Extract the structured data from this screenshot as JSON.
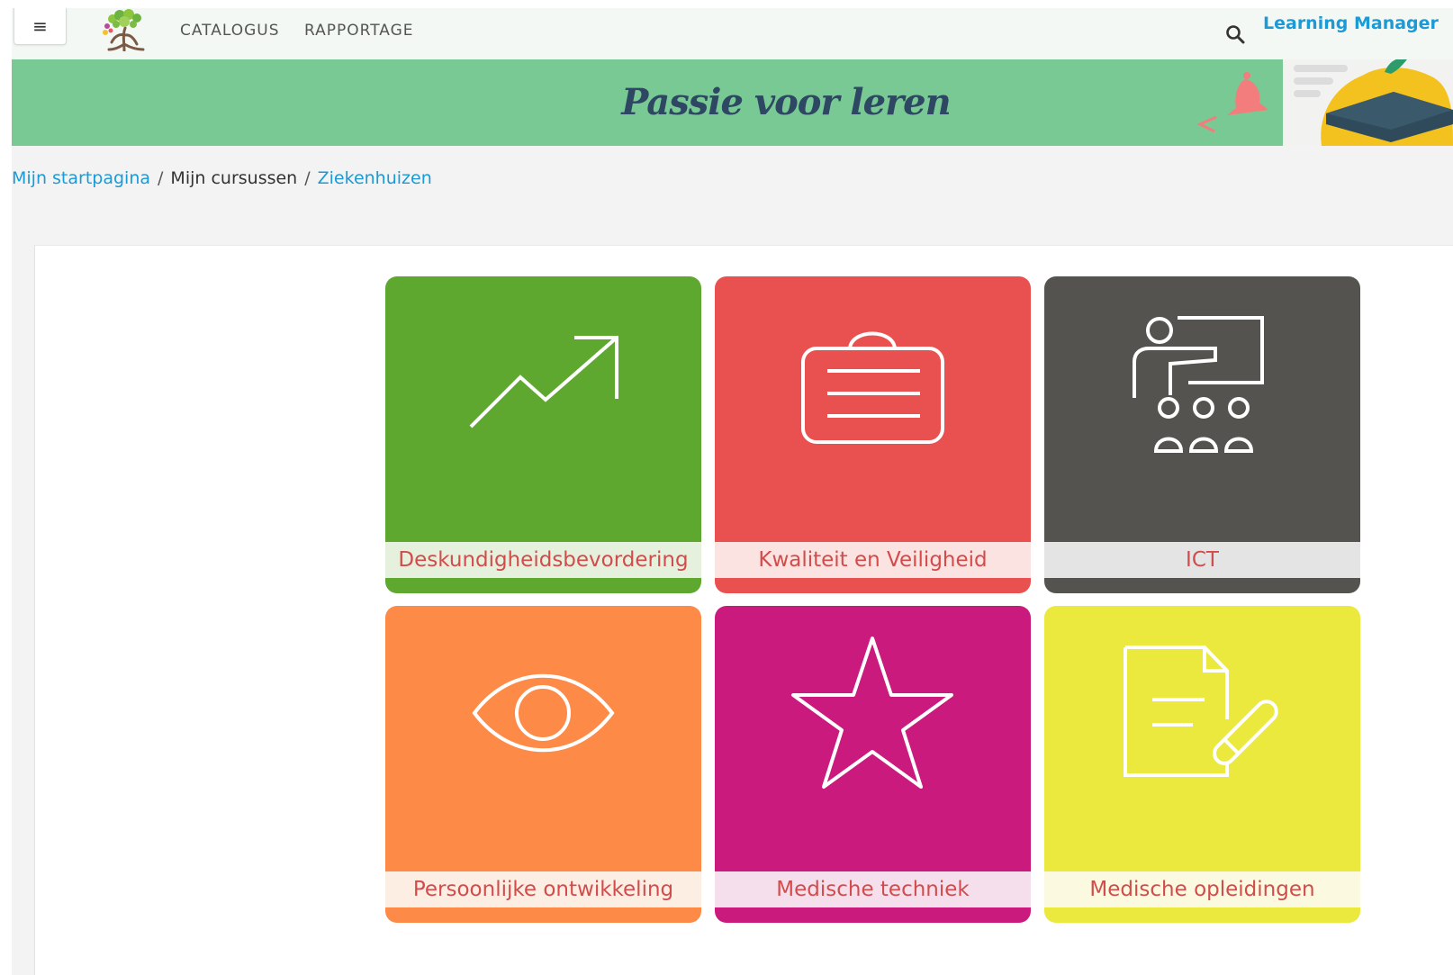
{
  "nav": {
    "menu_glyph": "≡",
    "catalogus": "CATALOGUS",
    "rapportage": "RAPPORTAGE",
    "user": "Learning Manager"
  },
  "banner": {
    "title": "Passie voor leren"
  },
  "breadcrumb": {
    "home": "Mijn startpagina",
    "separator": "/",
    "courses": "Mijn cursussen",
    "category": "Ziekenhuizen"
  },
  "tiles": [
    {
      "label": "Deskundigheidsbevordering",
      "color": "#5fa82f",
      "label_bg": "#e6f1dd",
      "icon": "trend-up-icon"
    },
    {
      "label": "Kwaliteit en Veiligheid",
      "color": "#e8514f",
      "label_bg": "#fbe3e2",
      "icon": "briefcase-icon"
    },
    {
      "label": "ICT",
      "color": "#555350",
      "label_bg": "#e4e4e4",
      "icon": "teacher-class-icon"
    },
    {
      "label": "Persoonlijke ontwikkeling",
      "color": "#fd8a46",
      "label_bg": "#fdeee4",
      "icon": "eye-icon"
    },
    {
      "label": "Medische techniek",
      "color": "#ca1a7d",
      "label_bg": "#f6dfec",
      "icon": "star-icon"
    },
    {
      "label": "Medische opleidingen",
      "color": "#ebe83e",
      "label_bg": "#fbfae0",
      "icon": "document-pencil-icon"
    }
  ],
  "colors": {
    "banner_green": "#79c995",
    "banner_text": "#2e4762",
    "link_blue": "#1a9ad6",
    "tile_label_text": "#d24c4c"
  }
}
